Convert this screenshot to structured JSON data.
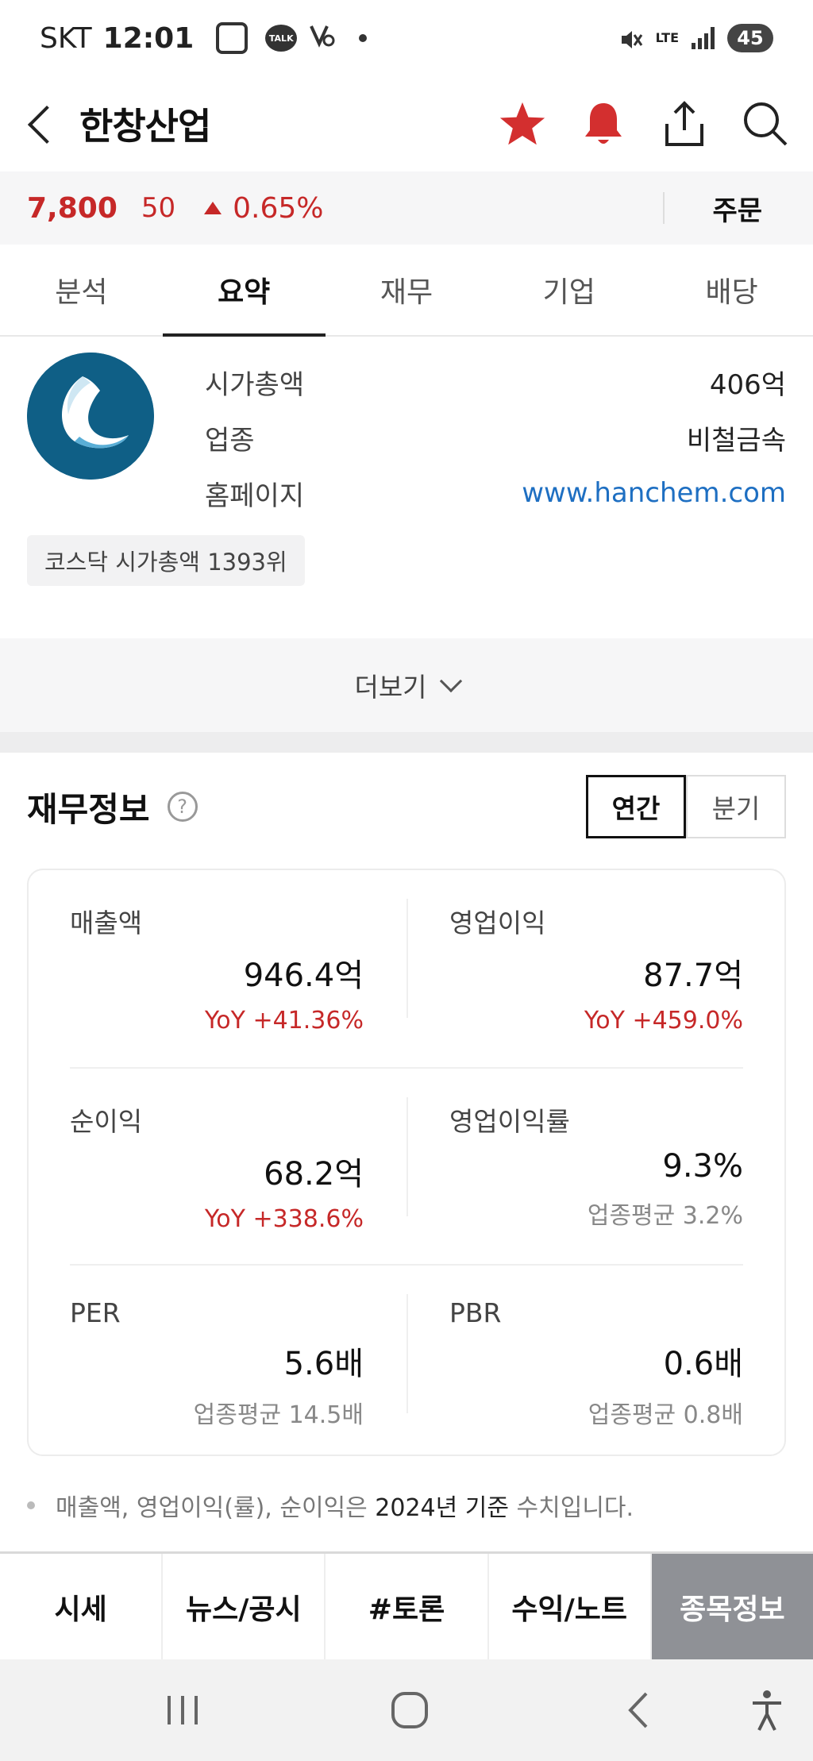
{
  "status_bar": {
    "carrier": "SKT",
    "time": "12:01",
    "talk": "TALK",
    "lte": "LTE",
    "battery": "45"
  },
  "header": {
    "title": "한창산업"
  },
  "price": {
    "current": "7,800",
    "change": "50",
    "percent": "0.65%",
    "order_label": "주문"
  },
  "tabs": [
    {
      "label": "분석"
    },
    {
      "label": "요약"
    },
    {
      "label": "재무"
    },
    {
      "label": "기업"
    },
    {
      "label": "배당"
    }
  ],
  "company": {
    "market_cap_label": "시가총액",
    "market_cap": "406억",
    "industry_label": "업종",
    "industry": "비철금속",
    "homepage_label": "홈페이지",
    "homepage": "www.hanchem.com",
    "rank": "코스닥 시가총액 1393위"
  },
  "more_label": "더보기",
  "financial": {
    "title": "재무정보",
    "help": "?",
    "period_annual": "연간",
    "period_quarter": "분기",
    "items": {
      "revenue": {
        "label": "매출액",
        "value": "946.4억",
        "sub": "YoY +41.36%"
      },
      "op_income": {
        "label": "영업이익",
        "value": "87.7억",
        "sub": "YoY +459.0%"
      },
      "net_income": {
        "label": "순이익",
        "value": "68.2억",
        "sub": "YoY +338.6%"
      },
      "op_margin": {
        "label": "영업이익률",
        "value": "9.3%",
        "sub": "업종평균 3.2%"
      },
      "per": {
        "label": "PER",
        "value": "5.6배",
        "sub": "업종평균 14.5배"
      },
      "pbr": {
        "label": "PBR",
        "value": "0.6배",
        "sub": "업종평균 0.8배"
      }
    },
    "note_prefix": "매출액, 영업이익(률), 순이익은 ",
    "note_highlight": "2024년 기준",
    "note_suffix": " 수치입니다."
  },
  "bottom_tabs": [
    {
      "label": "시세"
    },
    {
      "label": "뉴스/공시"
    },
    {
      "label": "#토론"
    },
    {
      "label": "수익/노트"
    },
    {
      "label": "종목정보"
    }
  ],
  "colors": {
    "up_red": "#c62828",
    "link_blue": "#1e6fc2",
    "logo_blue": "#0f5f86"
  }
}
